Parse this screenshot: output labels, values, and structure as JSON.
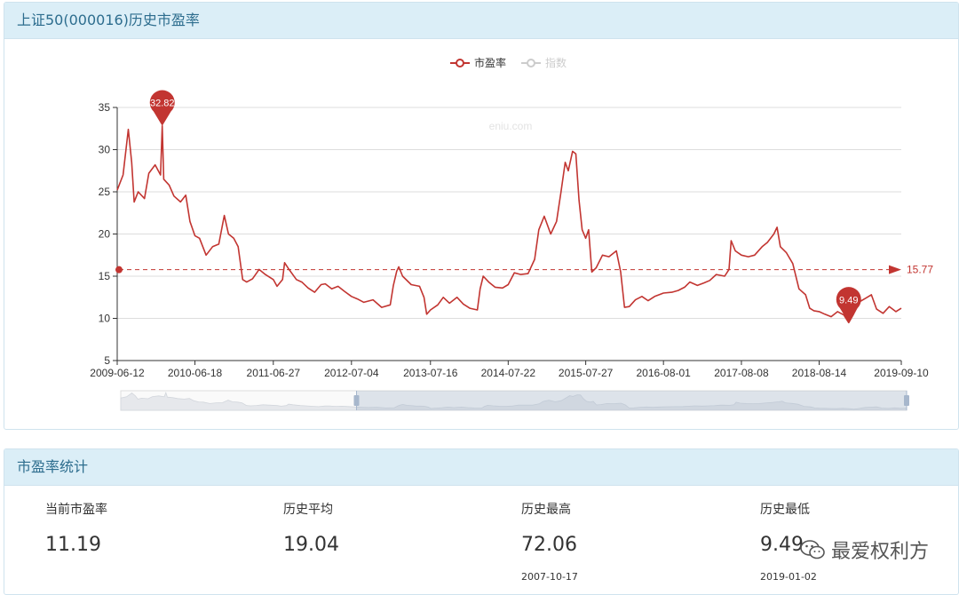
{
  "chart_panel": {
    "title": "上证50(000016)历史市盈率"
  },
  "stats_panel": {
    "title": "市盈率统计"
  },
  "chart_data": {
    "type": "line",
    "title": "",
    "xlabel": "",
    "ylabel": "",
    "ylim": [
      5,
      35
    ],
    "y_ticks": [
      5,
      10,
      15,
      20,
      25,
      30,
      35
    ],
    "x_tick_labels": [
      "2009-06-12",
      "2010-06-18",
      "2011-06-27",
      "2012-07-04",
      "2013-07-16",
      "2014-07-22",
      "2015-07-27",
      "2016-08-01",
      "2017-08-08",
      "2018-08-14",
      "2019-09-10"
    ],
    "legend": [
      "市盈率",
      "指数"
    ],
    "watermark_text": "eniu.com",
    "series": [
      {
        "name": "市盈率",
        "color": "#c23531",
        "points": [
          [
            "2009-06-12",
            25.2
          ],
          [
            "2009-07-10",
            27.0
          ],
          [
            "2009-08-04",
            32.4
          ],
          [
            "2009-08-20",
            28.5
          ],
          [
            "2009-09-01",
            23.8
          ],
          [
            "2009-09-20",
            25.0
          ],
          [
            "2009-10-20",
            24.2
          ],
          [
            "2009-11-10",
            27.2
          ],
          [
            "2009-12-10",
            28.2
          ],
          [
            "2010-01-05",
            27.0
          ],
          [
            "2010-01-13",
            32.82
          ],
          [
            "2010-01-20",
            26.5
          ],
          [
            "2010-02-15",
            25.8
          ],
          [
            "2010-03-10",
            24.5
          ],
          [
            "2010-04-10",
            23.8
          ],
          [
            "2010-05-05",
            24.6
          ],
          [
            "2010-05-25",
            21.5
          ],
          [
            "2010-06-18",
            19.8
          ],
          [
            "2010-07-10",
            19.5
          ],
          [
            "2010-08-10",
            17.5
          ],
          [
            "2010-09-10",
            18.5
          ],
          [
            "2010-10-10",
            18.8
          ],
          [
            "2010-11-05",
            22.2
          ],
          [
            "2010-11-25",
            20.0
          ],
          [
            "2010-12-20",
            19.5
          ],
          [
            "2011-01-10",
            18.5
          ],
          [
            "2011-02-01",
            14.6
          ],
          [
            "2011-02-20",
            14.3
          ],
          [
            "2011-03-20",
            14.7
          ],
          [
            "2011-04-20",
            15.8
          ],
          [
            "2011-05-20",
            15.2
          ],
          [
            "2011-06-27",
            14.6
          ],
          [
            "2011-07-15",
            13.8
          ],
          [
            "2011-08-10",
            14.6
          ],
          [
            "2011-08-20",
            16.6
          ],
          [
            "2011-09-10",
            15.8
          ],
          [
            "2011-10-15",
            14.6
          ],
          [
            "2011-11-10",
            14.3
          ],
          [
            "2011-12-10",
            13.6
          ],
          [
            "2012-01-10",
            13.1
          ],
          [
            "2012-02-10",
            14.0
          ],
          [
            "2012-03-01",
            14.1
          ],
          [
            "2012-04-01",
            13.5
          ],
          [
            "2012-05-01",
            13.8
          ],
          [
            "2012-06-01",
            13.2
          ],
          [
            "2012-07-04",
            12.6
          ],
          [
            "2012-08-01",
            12.3
          ],
          [
            "2012-09-01",
            11.9
          ],
          [
            "2012-10-15",
            12.2
          ],
          [
            "2012-11-25",
            11.3
          ],
          [
            "2013-01-05",
            11.6
          ],
          [
            "2013-01-20",
            13.9
          ],
          [
            "2013-02-05",
            15.6
          ],
          [
            "2013-02-15",
            16.1
          ],
          [
            "2013-03-05",
            15.0
          ],
          [
            "2013-04-15",
            14.0
          ],
          [
            "2013-05-25",
            13.8
          ],
          [
            "2013-06-15",
            12.5
          ],
          [
            "2013-06-28",
            10.5
          ],
          [
            "2013-07-16",
            11.0
          ],
          [
            "2013-08-20",
            11.6
          ],
          [
            "2013-09-15",
            12.5
          ],
          [
            "2013-10-15",
            11.8
          ],
          [
            "2013-11-20",
            12.5
          ],
          [
            "2013-12-20",
            11.7
          ],
          [
            "2014-01-20",
            11.2
          ],
          [
            "2014-02-25",
            11.0
          ],
          [
            "2014-03-10",
            13.5
          ],
          [
            "2014-03-25",
            15.0
          ],
          [
            "2014-04-20",
            14.3
          ],
          [
            "2014-05-20",
            13.7
          ],
          [
            "2014-06-25",
            13.6
          ],
          [
            "2014-07-22",
            14.0
          ],
          [
            "2014-08-20",
            15.4
          ],
          [
            "2014-09-20",
            15.2
          ],
          [
            "2014-10-25",
            15.3
          ],
          [
            "2014-11-25",
            17.0
          ],
          [
            "2014-12-15",
            20.5
          ],
          [
            "2015-01-10",
            22.1
          ],
          [
            "2015-02-10",
            20.0
          ],
          [
            "2015-03-10",
            21.5
          ],
          [
            "2015-03-31",
            25.0
          ],
          [
            "2015-04-20",
            28.5
          ],
          [
            "2015-05-05",
            27.5
          ],
          [
            "2015-05-25",
            29.8
          ],
          [
            "2015-06-10",
            29.5
          ],
          [
            "2015-06-25",
            24.0
          ],
          [
            "2015-07-10",
            20.5
          ],
          [
            "2015-07-27",
            19.5
          ],
          [
            "2015-08-10",
            20.5
          ],
          [
            "2015-08-25",
            15.5
          ],
          [
            "2015-09-15",
            16.0
          ],
          [
            "2015-10-15",
            17.5
          ],
          [
            "2015-11-15",
            17.3
          ],
          [
            "2015-12-20",
            18.0
          ],
          [
            "2016-01-10",
            15.5
          ],
          [
            "2016-01-28",
            11.3
          ],
          [
            "2016-02-20",
            11.4
          ],
          [
            "2016-03-20",
            12.2
          ],
          [
            "2016-04-20",
            12.6
          ],
          [
            "2016-05-20",
            12.1
          ],
          [
            "2016-06-20",
            12.6
          ],
          [
            "2016-08-01",
            13.0
          ],
          [
            "2016-09-10",
            13.1
          ],
          [
            "2016-10-10",
            13.3
          ],
          [
            "2016-11-10",
            13.7
          ],
          [
            "2016-12-05",
            14.3
          ],
          [
            "2017-01-10",
            13.9
          ],
          [
            "2017-02-10",
            14.2
          ],
          [
            "2017-03-10",
            14.5
          ],
          [
            "2017-04-10",
            15.2
          ],
          [
            "2017-05-20",
            15.0
          ],
          [
            "2017-06-10",
            15.8
          ],
          [
            "2017-06-20",
            19.2
          ],
          [
            "2017-07-10",
            18.0
          ],
          [
            "2017-08-08",
            17.5
          ],
          [
            "2017-09-10",
            17.3
          ],
          [
            "2017-10-10",
            17.5
          ],
          [
            "2017-11-15",
            18.5
          ],
          [
            "2017-12-10",
            19.0
          ],
          [
            "2018-01-10",
            20.0
          ],
          [
            "2018-01-25",
            20.8
          ],
          [
            "2018-02-10",
            18.5
          ],
          [
            "2018-03-10",
            17.8
          ],
          [
            "2018-04-10",
            16.5
          ],
          [
            "2018-05-10",
            13.5
          ],
          [
            "2018-06-10",
            12.8
          ],
          [
            "2018-06-30",
            11.2
          ],
          [
            "2018-07-20",
            10.9
          ],
          [
            "2018-08-14",
            10.8
          ],
          [
            "2018-09-10",
            10.5
          ],
          [
            "2018-10-10",
            10.2
          ],
          [
            "2018-11-10",
            10.8
          ],
          [
            "2018-12-10",
            10.4
          ],
          [
            "2019-01-02",
            9.49
          ],
          [
            "2019-01-25",
            10.5
          ],
          [
            "2019-02-25",
            12.0
          ],
          [
            "2019-03-25",
            12.4
          ],
          [
            "2019-04-20",
            12.8
          ],
          [
            "2019-05-15",
            11.1
          ],
          [
            "2019-06-15",
            10.6
          ],
          [
            "2019-07-15",
            11.4
          ],
          [
            "2019-08-15",
            10.8
          ],
          [
            "2019-09-10",
            11.2
          ]
        ]
      },
      {
        "name": "指数",
        "color": "#cccccc",
        "visible": false,
        "points": []
      }
    ],
    "mark_points": [
      {
        "type": "max",
        "label": "32.82",
        "x": "2010-01-13",
        "y": 32.82
      },
      {
        "type": "min",
        "label": "9.49",
        "x": "2019-01-02",
        "y": 9.49
      }
    ],
    "mark_line": {
      "type": "average",
      "label": "15.77",
      "y": 15.77
    },
    "zoom_range": [
      0.3,
      1.0
    ]
  },
  "stats": [
    {
      "label": "当前市盈率",
      "value": "11.19",
      "date": ""
    },
    {
      "label": "历史平均",
      "value": "19.04",
      "date": ""
    },
    {
      "label": "历史最高",
      "value": "72.06",
      "date": "2007-10-17"
    },
    {
      "label": "历史最低",
      "value": "9.49",
      "date": "2019-01-02"
    }
  ],
  "watermark": {
    "text": "最爱权利方"
  }
}
